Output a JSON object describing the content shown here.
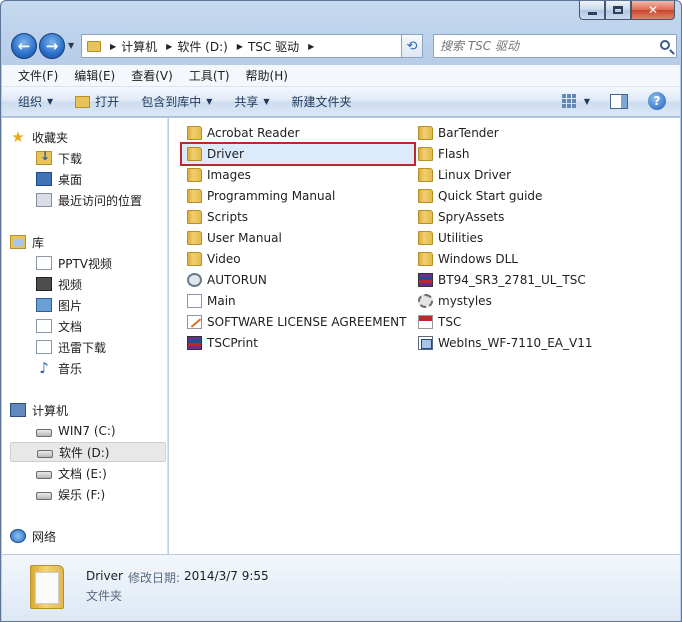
{
  "address": {
    "segments": [
      "计算机",
      "软件 (D:)",
      "TSC 驱动"
    ]
  },
  "search": {
    "placeholder": "搜索 TSC 驱动"
  },
  "menu": [
    "文件(F)",
    "编辑(E)",
    "查看(V)",
    "工具(T)",
    "帮助(H)"
  ],
  "toolbar": {
    "organize": "组织",
    "open": "打开",
    "include": "包含到库中",
    "share": "共享",
    "new_folder": "新建文件夹"
  },
  "sidebar": {
    "favorites": "收藏夹",
    "downloads": "下载",
    "desktop": "桌面",
    "recent": "最近访问的位置",
    "libraries": "库",
    "pptv": "PPTV视频",
    "videos": "视频",
    "pictures": "图片",
    "documents": "文档",
    "xunlei": "迅雷下载",
    "music": "音乐",
    "computer": "计算机",
    "drive_c": "WIN7 (C:)",
    "drive_d": "软件 (D:)",
    "drive_e": "文档 (E:)",
    "drive_f": "娱乐 (F:)",
    "network": "网络"
  },
  "files_left": [
    {
      "name": "Acrobat Reader",
      "icon": "folder-icon"
    },
    {
      "name": "Driver",
      "icon": "folder-icon"
    },
    {
      "name": "Images",
      "icon": "folder-icon"
    },
    {
      "name": "Programming Manual",
      "icon": "folder-icon"
    },
    {
      "name": "Scripts",
      "icon": "folder-icon"
    },
    {
      "name": "User Manual",
      "icon": "folder-icon"
    },
    {
      "name": "Video",
      "icon": "folder-icon"
    },
    {
      "name": "AUTORUN",
      "icon": "autorun-icon"
    },
    {
      "name": "Main",
      "icon": "blank-file-icon"
    },
    {
      "name": "SOFTWARE LICENSE AGREEMENT",
      "icon": "license-file-icon"
    },
    {
      "name": "TSCPrint",
      "icon": "archive-icon"
    }
  ],
  "files_right": [
    {
      "name": "BarTender",
      "icon": "folder-icon"
    },
    {
      "name": "Flash",
      "icon": "folder-icon"
    },
    {
      "name": "Linux Driver",
      "icon": "folder-icon"
    },
    {
      "name": "Quick Start guide",
      "icon": "folder-icon"
    },
    {
      "name": "SpryAssets",
      "icon": "folder-icon"
    },
    {
      "name": "Utilities",
      "icon": "folder-icon"
    },
    {
      "name": "Windows DLL",
      "icon": "folder-icon"
    },
    {
      "name": "BT94_SR3_2781_UL_TSC",
      "icon": "archive-icon"
    },
    {
      "name": "mystyles",
      "icon": "gear-file-icon"
    },
    {
      "name": "TSC",
      "icon": "tsc-file-icon"
    },
    {
      "name": "WebIns_WF-7110_EA_V11",
      "icon": "exe-icon"
    }
  ],
  "details": {
    "name": "Driver",
    "modified_label": "修改日期:",
    "modified_value": "2014/3/7 9:55",
    "type": "文件夹"
  },
  "colors": {
    "selection_border": "#c0272d",
    "accent": "#2a64b0"
  }
}
